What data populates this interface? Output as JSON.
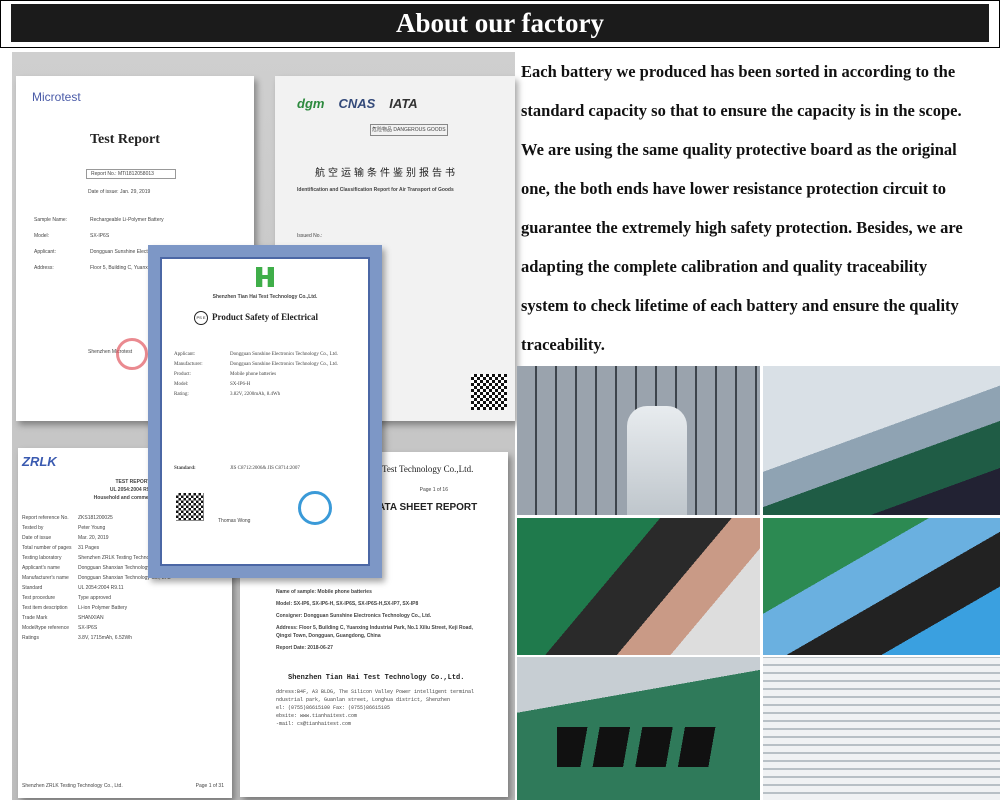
{
  "header": {
    "title": "About our factory"
  },
  "description": [
    "Each battery we produced has been sorted in according to the",
    "standard capacity so that to ensure the capacity is in the scope.",
    "We are using the same quality protective board as the original",
    " one, the both ends have lower resistance protection circuit to",
    "guarantee the extremely high safety protection. Besides, we are",
    "adapting the complete calibration and quality traceability",
    "system to check lifetime of each battery and ensure the quality",
    "traceability."
  ],
  "documents": {
    "microtest": {
      "logo": "Microtest",
      "title": "Test Report",
      "report_no": "Report No.: MTi1812058013",
      "date": "Date of issue: Jan. 29, 2019",
      "fields": [
        [
          "Sample Name:",
          "Rechargeable Li-Polymer Battery"
        ],
        [
          "Model:",
          "SX-IP6S"
        ],
        [
          "Applicant:",
          "Dongguan Sunshine Electro"
        ],
        [
          "Address:",
          "Floor 5, Building C, Yuanxin Keji Road, Qingxi Town, Do"
        ]
      ],
      "stamp": "Shenzhen Microtest"
    },
    "air": {
      "logos": [
        "dgm",
        "CNAS",
        "IATA"
      ],
      "stamp": "危险物品 DANGEROUS GOODS",
      "title_cn": "航空运输条件鉴别报告书",
      "title": "Identification and Classification Report for Air Transport of Goods",
      "issued_no_label": "Issued No.:"
    },
    "pse": {
      "company": "Shenzhen Tian Hai Test Technology Co.,Ltd.",
      "mark": "PS E",
      "title": "Product Safety of Electrical",
      "fields": [
        [
          "Applicant:",
          "Dongguan Sunshine Electronics Technology Co., Ltd."
        ],
        [
          "Manufacturer:",
          "Dongguan Sunshine Electronics Technology Co., Ltd."
        ],
        [
          "Product:",
          "Mobile phone batteries"
        ],
        [
          "Model:",
          "SX-IP6-H"
        ],
        [
          "Rating:",
          "3.82V, 2200mAh, 8.4Wh"
        ]
      ],
      "standard_label": "Standard:",
      "standard": "JIS C8712:2006& JIS C8714:2007",
      "signer": "Thomas Wong"
    },
    "zrlk": {
      "logo": "ZRLK",
      "title": "TEST REPORT",
      "standard": "UL 2054:2004 R9.11",
      "subtitle": "Household and commercial batte",
      "fields": [
        [
          "Report reference No.",
          "ZKS181200025"
        ],
        [
          "Tested by",
          "Peter Young"
        ],
        [
          "Date of issue",
          "Mar. 20, 2019"
        ],
        [
          "Total number of pages",
          "31 Pages"
        ],
        [
          "Testing laboratory",
          "Shenzhen ZRLK Testing Technology Co., Ltd."
        ],
        [
          "Applicant's name",
          "Dongguan Shanxian Technology Co., LTD"
        ],
        [
          "Manufacturer's name",
          "Dongguan Shanxian Technology Co., LTD"
        ],
        [
          "Standard",
          "UL 2054:2004 R9.11"
        ],
        [
          "Test procedure",
          "Type approved"
        ],
        [
          "Test item description",
          "Li-ion Polymer Battery"
        ],
        [
          "Trade Mark",
          "SHANXIAN"
        ],
        [
          "Model/type reference",
          "SX-IP6S"
        ],
        [
          "Ratings",
          "3.8V, 1715mAh, 6.52Wh"
        ]
      ],
      "footer": "Shenzhen ZRLK Testing Technology Co., Ltd.",
      "page": "Page 1 of 31"
    },
    "datasheet": {
      "header": "Test Technology Co.,Ltd.",
      "page": "Page 1 of 16",
      "title": "ATA SHEET REPORT",
      "lines": [
        "Name of sample: Mobile phone batteries",
        "Model: SX-IP6, SX-IP6-H, SX-IP6S, SX-IP6S-H,SX-IP7, SX-IP8",
        "Consigner: Dongguan Sunshine Electronics Technology Co., Ltd.",
        "Address: Floor 5, Building C, Yuanxing Industrial Park, No.1 Xiliu Street, Keji Road, Qingxi Town, Dongguan, Guangdong, China",
        "Report Date: 2018-06-27"
      ],
      "company": "Shenzhen Tian Hai Test Technology Co.,Ltd.",
      "contact": [
        "ddress:B4F, A3 BLDG, The Silicon Valley Power intelligent terminal",
        "ndustrial park, Guanlan street, Longhua district, Shenzhen",
        "el: (0755)86615100 Fax: (0755)86615105",
        "ebsite: www.tianhaitest.com",
        "-mail: cs@tianhaitest.com"
      ]
    }
  },
  "photos": [
    "battery-storage-shelves-worker",
    "conveyor-production-line",
    "battery-assembly-hands",
    "gloved-hands-testing-batteries",
    "batteries-on-conveyor",
    "warehouse-aging-racks"
  ]
}
